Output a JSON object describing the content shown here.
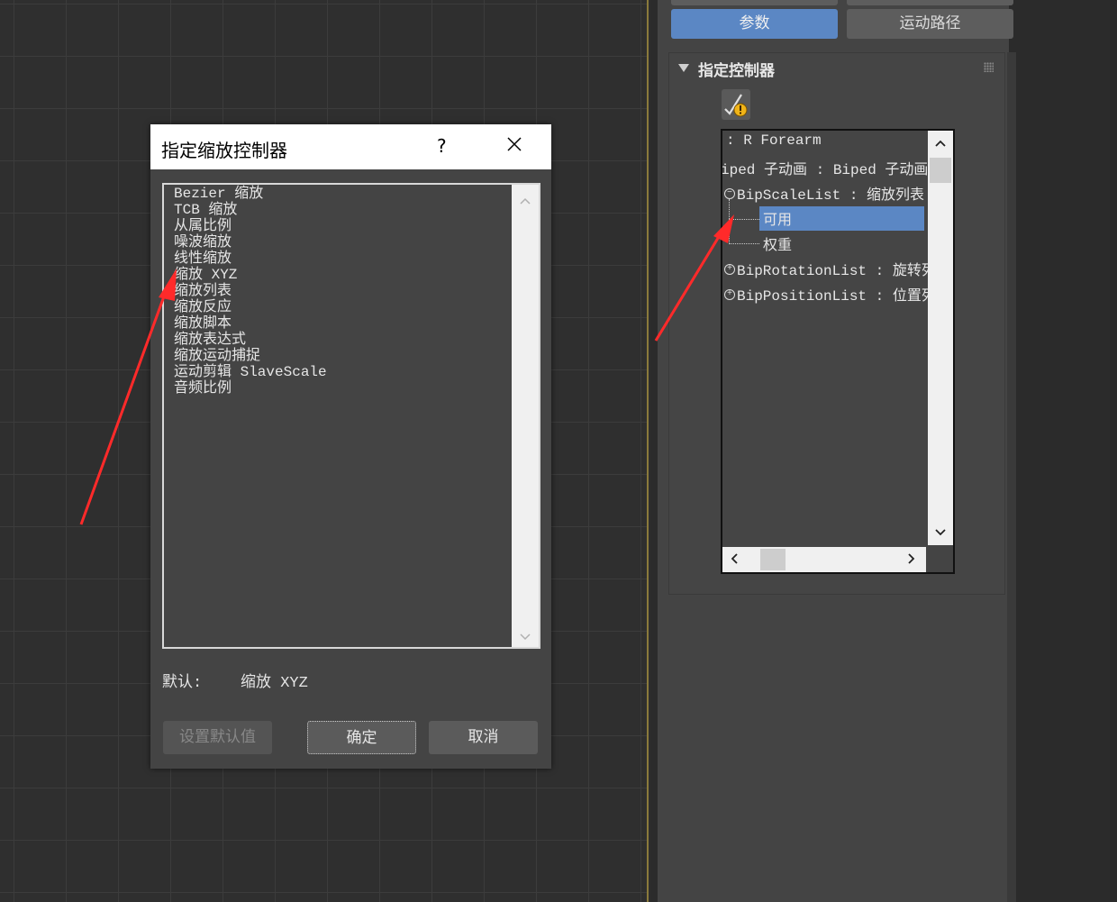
{
  "command_panel": {
    "tab_params": "参数",
    "tab_motion_paths": "运动路径",
    "rollout_title": "指定控制器",
    "tree": [
      {
        "text": ": R Forearm",
        "indent": 0
      },
      {
        "text": "iped 子动画  : Biped 子动画",
        "indent": 0
      },
      {
        "text": "BipScaleList : 缩放列表",
        "indent": 1,
        "toggle": "−"
      },
      {
        "text": "可用",
        "indent": 2,
        "selected": true
      },
      {
        "text": "权重",
        "indent": 2
      },
      {
        "text": "BipRotationList : 旋转列表",
        "indent": 1,
        "toggle": "+"
      },
      {
        "text": "BipPositionList : 位置列表",
        "indent": 1,
        "toggle": "+"
      }
    ],
    "selection_color": "#5b87c4"
  },
  "dialog": {
    "title": "指定缩放控制器",
    "help_label": "?",
    "close_label": "✕",
    "items": [
      "Bezier 缩放",
      "TCB 缩放",
      "从属比例",
      "噪波缩放",
      "线性缩放",
      "缩放 XYZ",
      "缩放列表",
      "缩放反应",
      "缩放脚本",
      "缩放表达式",
      "缩放运动捕捉",
      "运动剪辑 SlaveScale",
      "音频比例"
    ],
    "default_label": "默认:",
    "default_value": "缩放 XYZ",
    "btn_set_default": "设置默认值",
    "btn_ok": "确定",
    "btn_cancel": "取消"
  },
  "colors": {
    "accent": "#5b87c4",
    "annotation_arrow": "#ff2a2a"
  }
}
